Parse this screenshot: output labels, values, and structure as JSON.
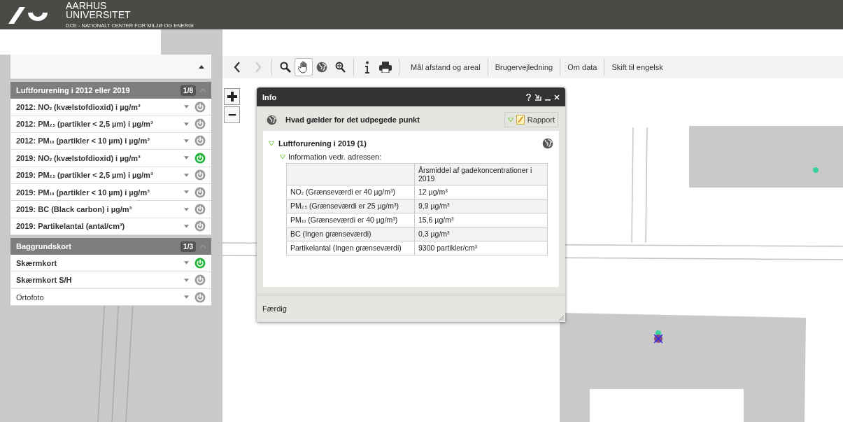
{
  "header": {
    "title_line1": "AARHUS",
    "title_line2": "UNIVERSITET",
    "subtitle": "DCE - NATIONALT CENTER FOR MILJØ OG ENERGI"
  },
  "sidebar": {
    "expanded": true,
    "groups": [
      {
        "title": "Luftforurening i 2012 eller 2019",
        "count": "1/8",
        "expanded": true,
        "layers": [
          {
            "label": "2012: NO$_{2}$ (kvælstofdioxid) i µg/m³",
            "on": false
          },
          {
            "label": "2012: PM$_{2.5}$ (partikler < 2,5 µm) i µg/m³",
            "on": false
          },
          {
            "label": "2012: PM$_{10}$ (partikler < 10 µm) i µg/m³",
            "on": false
          },
          {
            "label": "2019: NO$_{2}$ (kvælstofdioxid) i µg/m³",
            "on": true
          },
          {
            "label": "2019: PM$_{2.5}$ (partikler < 2,5 µm) i µg/m³",
            "on": false
          },
          {
            "label": "2019: PM$_{10}$ (partikler < 10 µm) i µg/m³",
            "on": false
          },
          {
            "label": "2019: BC (Black carbon) i µg/m³",
            "on": false
          },
          {
            "label": "2019: Partikelantal (antal/cm³)",
            "on": false
          }
        ]
      },
      {
        "title": "Baggrundskort",
        "count": "1/3",
        "expanded": true,
        "layers": [
          {
            "label": "Skærmkort",
            "on": true
          },
          {
            "label": "Skærmkort S/H",
            "on": false
          },
          {
            "label": "Ortofoto",
            "on": false
          }
        ]
      }
    ]
  },
  "toolbar": {
    "tools": [
      {
        "kind": "back",
        "disabled": false
      },
      {
        "kind": "forward",
        "disabled": true
      },
      {
        "kind": "zoom",
        "selected": false
      },
      {
        "kind": "pan",
        "selected": true
      },
      {
        "kind": "globe",
        "selected": false
      },
      {
        "kind": "query",
        "selected": false
      },
      {
        "kind": "info",
        "selected": false
      },
      {
        "kind": "print",
        "selected": false
      }
    ],
    "links": [
      "Mål afstand og areal",
      "Brugervejledning",
      "Om data",
      "Skift til engelsk"
    ]
  },
  "dialog": {
    "title": "Info",
    "subtitle": "Hvad gælder for det udpegede punkt",
    "report_button": "Rapport",
    "section": {
      "title": "Luftforurening i 2019 (1)",
      "expanded": true,
      "subsection": {
        "title": "Information vedr. adressen:",
        "expanded": true,
        "table": {
          "column_2_header": "Årsmiddel af gadekoncentrationer i 2019",
          "rows": [
            [
              "NO$_{2}$ (Grænseværdi er 40 µg/m³)",
              "12 µg/m³"
            ],
            [
              "PM$_{2.5}$ (Grænseværdi er 25 µg/m³)",
              "9,9 µg/m³"
            ],
            [
              "PM$_{10}$ (Grænseværdi er 40 µg/m³)",
              "15,6 µg/m³"
            ],
            [
              "BC (Ingen grænseværdi)",
              "0,3 µg/m³"
            ],
            [
              "Partikelantal (Ingen grænseværdi)",
              "9300 partikler/cm³"
            ]
          ]
        }
      }
    },
    "footer_button": "Færdig"
  }
}
